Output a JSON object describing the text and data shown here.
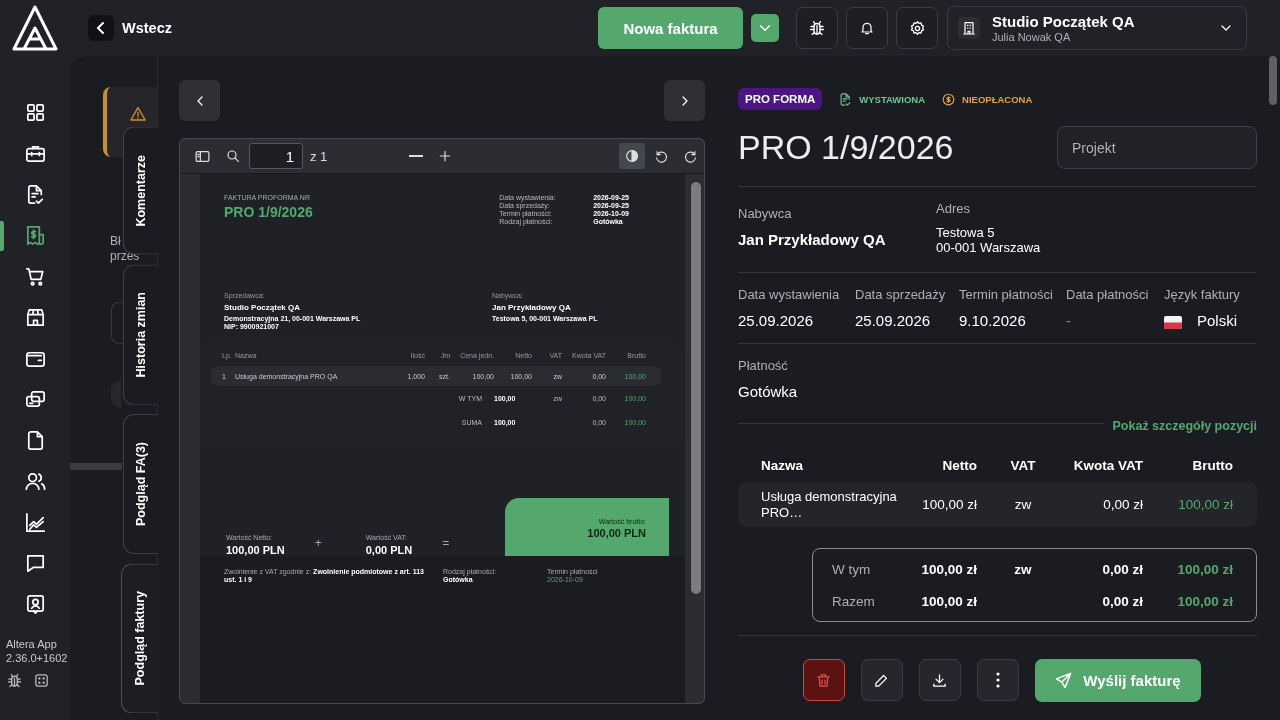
{
  "topbar": {
    "back_label": "Wstecz",
    "new_invoice_label": "Nowa faktura",
    "company": {
      "name": "Studio Początek QA",
      "user": "Julia Nowak QA"
    }
  },
  "sidebar": {
    "items": [
      {
        "selected": false
      },
      {
        "selected": false
      },
      {
        "selected": false
      },
      {
        "selected": true
      },
      {
        "selected": false
      },
      {
        "selected": false
      },
      {
        "selected": false
      },
      {
        "selected": false
      },
      {
        "selected": false
      },
      {
        "selected": false
      },
      {
        "selected": false
      },
      {
        "selected": false
      },
      {
        "selected": false
      }
    ],
    "app_name": "Altera App",
    "version": "2.36.0+1602"
  },
  "background_page": {
    "text_lines": [
      "Bł",
      "przes"
    ]
  },
  "side_tabs": [
    {
      "label": "Komentarze",
      "selected": false
    },
    {
      "label": "Historia zmian",
      "selected": false
    },
    {
      "label": "Podgląd FA(3)",
      "selected": false
    },
    {
      "label": "Podgląd faktury",
      "selected": true
    }
  ],
  "pdf_viewer": {
    "page": "1",
    "page_count": "z 1",
    "document": {
      "title_label": "FAKTURA PROFORMA NR",
      "number": "PRO 1/9/2026",
      "meta": [
        {
          "label": "Data wystawienia:",
          "value": "2026-09-25"
        },
        {
          "label": "Data sprzedaży:",
          "value": "2026-09-25"
        },
        {
          "label": "Termin płatności:",
          "value": "2026-10-09"
        },
        {
          "label": "Rodzaj płatności:",
          "value": "Gotówka"
        }
      ],
      "seller": {
        "label": "Sprzedawca:",
        "name": "Studio Początek QA",
        "lines": [
          "Demonstracyjna 21, 00-001 Warszawa PL",
          "NIP: 9900921007"
        ]
      },
      "buyer": {
        "label": "Nabywca:",
        "name": "Jan Przykładowy QA",
        "lines": [
          "Testowa 5, 00-001 Warszawa PL"
        ]
      },
      "columns": [
        "Lp.",
        "Nazwa",
        "Ilość",
        "Jm",
        "Cena jedn.",
        "Netto",
        "VAT",
        "Kwota VAT",
        "Brutto"
      ],
      "rows": [
        [
          "1",
          "Usługa demonstracyjna PRO QA",
          "1,000",
          "szt.",
          "100,00",
          "100,00",
          "zw",
          "0,00",
          "100,00"
        ]
      ],
      "summary": [
        {
          "label": "W TYM",
          "netto": "100,00",
          "vat": "zw",
          "vat_amount": "0,00",
          "brutto": "100,00"
        },
        {
          "label": "SUMA",
          "netto": "100,00",
          "vat_amount": "0,00",
          "brutto": "100,00"
        }
      ],
      "totals": {
        "net": {
          "label": "Wartość Netto:",
          "value": "100,00 PLN"
        },
        "plus": "+",
        "vat": {
          "label": "Wartość VAT:",
          "value": "0,00 PLN"
        },
        "equals": "=",
        "gross": {
          "label": "Wartość brutto:",
          "value": "100,00 PLN"
        }
      },
      "footer": {
        "exemption": "Zwolnienie z VAT zgodnie z: **Zwolnienie podmiotowe z art. 113 ust. 1 i 9**",
        "payment_label": "Rodzaj płatności:",
        "payment_value": "Gotówka",
        "due_label": "Termin płatności",
        "due_value": "2026-10-09"
      }
    }
  },
  "invoice": {
    "badges": [
      {
        "kind": "type",
        "label": "PRO FORMA"
      },
      {
        "kind": "issued",
        "label": "WYSTAWIONA"
      },
      {
        "kind": "unpaid",
        "label": "NIEOPŁACONA"
      }
    ],
    "number": "PRO 1/9/2026",
    "project_placeholder": "Projekt",
    "buyer": {
      "label": "Nabywca",
      "name": "Jan Przykładowy QA"
    },
    "address": {
      "label": "Adres",
      "lines": [
        "Testowa 5",
        "00-001 Warszawa"
      ]
    },
    "dates": [
      {
        "label": "Data wystawienia",
        "value": "25.09.2026",
        "kind": "date"
      },
      {
        "label": "Data sprzedaży",
        "value": "25.09.2026",
        "kind": "date"
      },
      {
        "label": "Termin płatności",
        "value": "9.10.2026",
        "kind": "date"
      },
      {
        "label": "Data płatności",
        "value": "-",
        "kind": "empty"
      }
    ],
    "language": {
      "label": "Język faktury",
      "value": "Polski"
    },
    "payment": {
      "label": "Płatność",
      "value": "Gotówka"
    },
    "details_link": "Pokaż szczegóły pozycji",
    "columns": [
      "Nazwa",
      "Netto",
      "VAT",
      "Kwota VAT",
      "Brutto"
    ],
    "rows": [
      [
        "Usługa demonstracyjna PRO…",
        "100,00 zł",
        "zw",
        "0,00 zł",
        "100,00 zł"
      ]
    ],
    "summary": [
      {
        "label": "W tym",
        "netto": "100,00 zł",
        "vat": "zw",
        "vat_amount": "0,00 zł",
        "brutto": "100,00 zł"
      },
      {
        "label": "Razem",
        "netto": "100,00 zł",
        "vat_amount": "0,00 zł",
        "brutto": "100,00 zł"
      }
    ],
    "send_label": "Wyślij fakturę"
  }
}
